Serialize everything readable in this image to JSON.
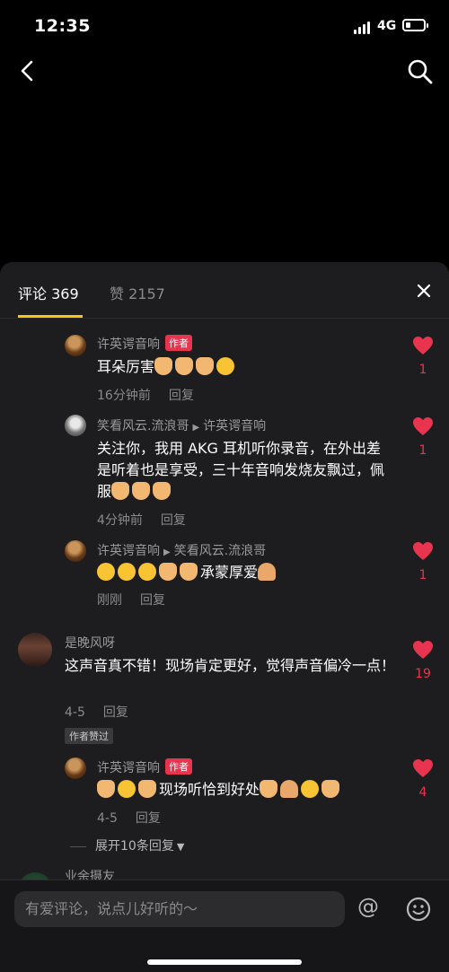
{
  "status": {
    "time": "12:35",
    "network": "4G"
  },
  "tabs": {
    "comments": "评论 369",
    "likes": "赞 2157"
  },
  "comments": [
    {
      "user": "许英谔音响",
      "author_tag": "作者",
      "text": "耳朵厉害",
      "time": "16分钟前",
      "reply": "回复",
      "likes": "1"
    },
    {
      "user": "笑看风云.流浪哥",
      "reply_to": "许英谔音响",
      "text": "关注你，我用 AKG 耳机听你录音，在外出差是听着也是享受，三十年音响发烧友飘过，佩服",
      "time": "4分钟前",
      "reply": "回复",
      "likes": "1"
    },
    {
      "user": "许英谔音响",
      "reply_to": "笑看风云.流浪哥",
      "text": "承蒙厚爱",
      "time": "刚刚",
      "reply": "回复",
      "likes": "1"
    },
    {
      "user": "是晚风呀",
      "text": "这声音真不错！现场肯定更好，觉得声音偏冷一点！",
      "time": "4-5",
      "reply": "回复",
      "likes": "19",
      "badge": "作者赞过"
    },
    {
      "user": "许英谔音响",
      "author_tag": "作者",
      "text": "现场听恰到好处",
      "time": "4-5",
      "reply": "回复",
      "likes": "4"
    }
  ],
  "expand_label": "展开10条回复",
  "partial_user": "业余摄友",
  "input": {
    "placeholder": "有爱评论，说点儿好听的～"
  },
  "icons": {
    "back": "back-arrow-icon",
    "search": "search-icon",
    "close": "close-icon",
    "heart": "heart-icon",
    "at": "at-icon",
    "emoji": "emoji-icon"
  },
  "colors": {
    "accent": "#e9344f",
    "tab_underline": "#f5c518"
  }
}
